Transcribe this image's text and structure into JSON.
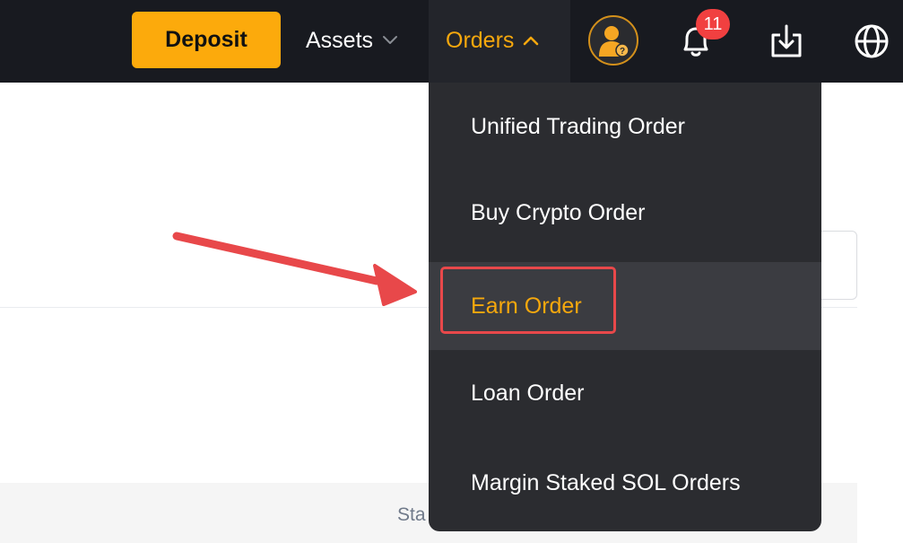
{
  "header": {
    "deposit_label": "Deposit",
    "assets_label": "Assets",
    "orders_label": "Orders",
    "notification_count": "11",
    "icons": {
      "avatar": "user-avatar-icon",
      "notifications": "bell-icon",
      "download": "download-icon",
      "language": "globe-icon"
    }
  },
  "orders_menu": {
    "items": [
      {
        "label": "Unified Trading Order"
      },
      {
        "label": "Buy Crypto Order"
      },
      {
        "label": "Earn Order",
        "highlighted": true
      },
      {
        "label": "Loan Order"
      },
      {
        "label": "Margin Staked SOL Orders"
      }
    ]
  },
  "page": {
    "table_header_partial": "Sta"
  },
  "colors": {
    "topbar": "#181a20",
    "accent": "#fcaa0c",
    "active_text": "#f6a80d",
    "dropdown_bg": "#2b2c30",
    "annotation_red": "#e8484a",
    "badge_red": "#f14040"
  }
}
